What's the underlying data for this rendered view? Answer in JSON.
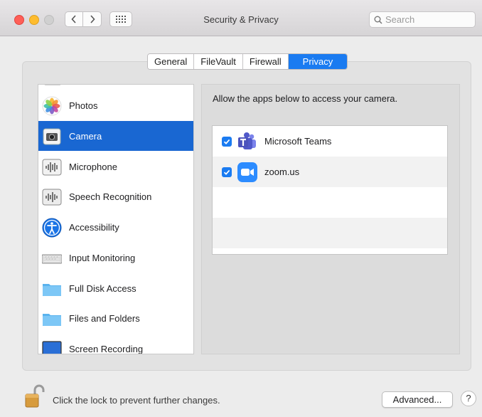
{
  "window": {
    "title": "Security & Privacy"
  },
  "toolbar": {
    "search_placeholder": "Search"
  },
  "tabs": [
    {
      "label": "General"
    },
    {
      "label": "FileVault"
    },
    {
      "label": "Firewall"
    },
    {
      "label": "Privacy"
    }
  ],
  "active_tab": "Privacy",
  "sidebar": {
    "items": [
      {
        "label": "Photos",
        "icon": "photos-icon"
      },
      {
        "label": "Camera",
        "icon": "camera-icon",
        "selected": true
      },
      {
        "label": "Microphone",
        "icon": "microphone-icon"
      },
      {
        "label": "Speech Recognition",
        "icon": "speech-recognition-icon"
      },
      {
        "label": "Accessibility",
        "icon": "accessibility-icon"
      },
      {
        "label": "Input Monitoring",
        "icon": "keyboard-icon"
      },
      {
        "label": "Full Disk Access",
        "icon": "folder-icon"
      },
      {
        "label": "Files and Folders",
        "icon": "folder-icon"
      },
      {
        "label": "Screen Recording",
        "icon": "screen-recording-icon"
      }
    ]
  },
  "main": {
    "caption": "Allow the apps below to access your camera.",
    "apps": [
      {
        "name": "Microsoft Teams",
        "checked": true,
        "icon": "microsoft-teams-icon"
      },
      {
        "name": "zoom.us",
        "checked": true,
        "icon": "zoom-icon"
      }
    ]
  },
  "footer": {
    "lock_text": "Click the lock to prevent further changes.",
    "advanced_label": "Advanced...",
    "help_label": "?"
  },
  "colors": {
    "accent": "#1a7bf1",
    "selection": "#1967d2",
    "close": "#fe5f57",
    "minimize": "#febc2e"
  }
}
